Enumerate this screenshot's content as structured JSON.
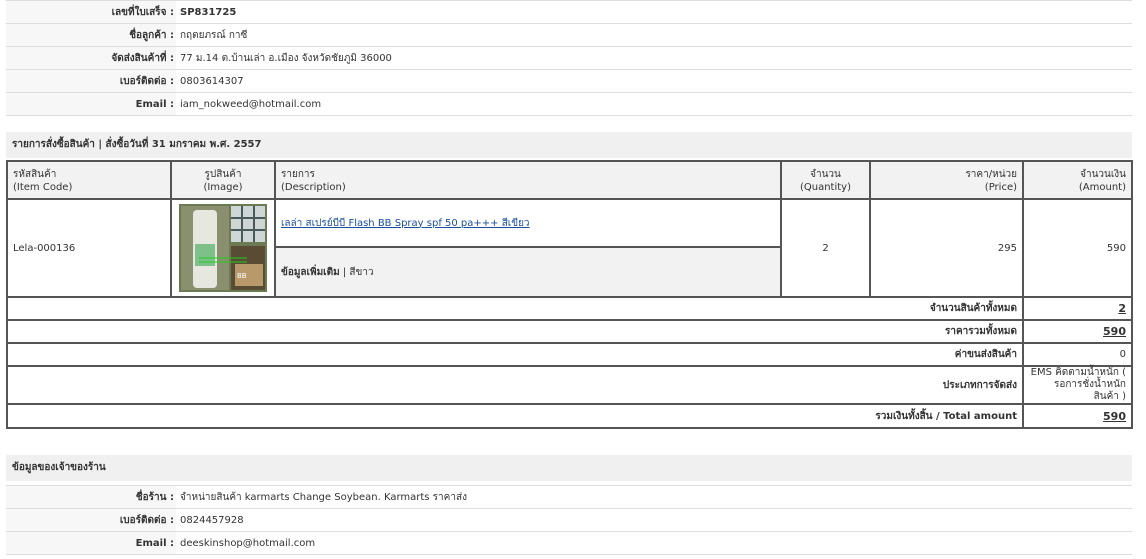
{
  "customer": {
    "rows": [
      {
        "label": "เลขที่ใบเสร็จ :",
        "value": "SP831725",
        "bold": true
      },
      {
        "label": "ชื่อลูกค้า :",
        "value": "กฤตยภรณ์  กาซี"
      },
      {
        "label": "จัดส่งสินค้าที่ :",
        "value": "77 ม.14 ต.บ้านเล่า อ.เมือง จังหวัดชัยภูมิ 36000"
      },
      {
        "label": "เบอร์ติดต่อ :",
        "value": "0803614307"
      },
      {
        "label": "Email :",
        "value": "iam_nokweed@hotmail.com"
      }
    ]
  },
  "order": {
    "title": "รายการสั่งซื้อสินค้า | สั่งซื้อวันที่ 31 มกราคม พ.ศ. 2557",
    "headers": {
      "code": "รหัสสินค้า",
      "code_en": "(Item Code)",
      "image": "รูปสินค้า",
      "image_en": "(Image)",
      "desc": "รายการ",
      "desc_en": "(Description)",
      "qty": "จำนวน",
      "qty_en": "(Quantity)",
      "price": "ราคา/หน่วย",
      "price_en": "(Price)",
      "amount": "จำนวนเงิน",
      "amount_en": "(Amount)"
    },
    "item": {
      "code": "Lela-000136",
      "name": "เลล่า สเปรย์บีบี Flash BB Spray spf 50 pa+++ สีเขียว",
      "extra_label": "ข้อมูลเพิ่มเติม",
      "extra_value": "| สีขาว",
      "qty": "2",
      "price": "295",
      "amount": "590"
    },
    "summary": {
      "total_qty_label": "จำนวนสินค้าทั้งหมด",
      "total_qty": "2",
      "total_price_label": "ราคารวมทั้งหมด",
      "total_price": "590",
      "shipping_label": "ค่าขนส่งสินค้า",
      "shipping": "0",
      "ship_type_label": "ประเภทการจัดส่ง",
      "ship_type": "EMS คิดตามน้ำหนัก ( รอการชั่งน้ำหนักสินค้า )",
      "grand_label": "รวมเงินทั้งสิ้น / Total amount",
      "grand": "590"
    }
  },
  "shop": {
    "title": "ข้อมูลของเจ้าของร้าน",
    "rows": [
      {
        "label": "ชื่อร้าน :",
        "value": "จำหน่ายสินค้า karmarts Change Soybean. Karmarts ราคาส่ง"
      },
      {
        "label": "เบอร์ติดต่อ :",
        "value": "0824457928"
      },
      {
        "label": "Email :",
        "value": "deeskinshop@hotmail.com"
      }
    ]
  },
  "colors": {
    "link": "#1a4fa0",
    "border": "#555555",
    "header_bg": "#f2f2f2"
  }
}
